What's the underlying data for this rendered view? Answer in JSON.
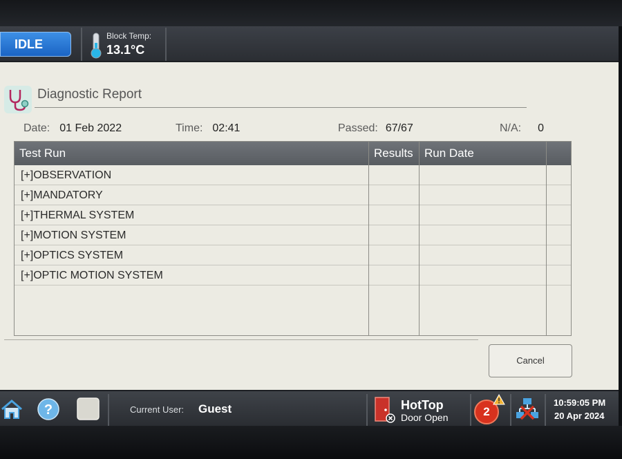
{
  "status": {
    "state_label": "IDLE"
  },
  "block_temp": {
    "label": "Block Temp:",
    "value": "13.1°C"
  },
  "report": {
    "title": "Diagnostic Report",
    "date_label": "Date:",
    "date_value": "01 Feb 2022",
    "time_label": "Time:",
    "time_value": "02:41",
    "passed_label": "Passed:",
    "passed_value": "67/67",
    "na_label": "N/A:",
    "na_value": "0"
  },
  "table": {
    "columns": [
      "Test Run",
      "Results",
      "Run Date"
    ],
    "rows": [
      {
        "label": "[+]OBSERVATION"
      },
      {
        "label": "[+]MANDATORY"
      },
      {
        "label": "[+]THERMAL SYSTEM"
      },
      {
        "label": "[+]MOTION SYSTEM"
      },
      {
        "label": "[+]OPTICS SYSTEM"
      },
      {
        "label": "[+]OPTIC MOTION SYSTEM"
      }
    ]
  },
  "actions": {
    "cancel_label": "Cancel"
  },
  "taskbar": {
    "current_user_label": "Current User:",
    "current_user_value": "Guest",
    "door_title": "HotTop",
    "door_status": "Door Open",
    "alert_count": "2",
    "clock_time": "10:59:05 PM",
    "clock_date": "20 Apr 2024"
  },
  "icons": {
    "home": "home-icon",
    "help": "help-icon",
    "blank": "blank-tile-icon",
    "thermometer": "thermometer-icon",
    "stethoscope": "stethoscope-icon",
    "door": "door-icon",
    "warning": "warning-icon",
    "network": "network-icon"
  },
  "colors": {
    "accent_blue": "#1b64c4",
    "alert_red": "#d8321e",
    "warning_yellow": "#f2b233"
  }
}
